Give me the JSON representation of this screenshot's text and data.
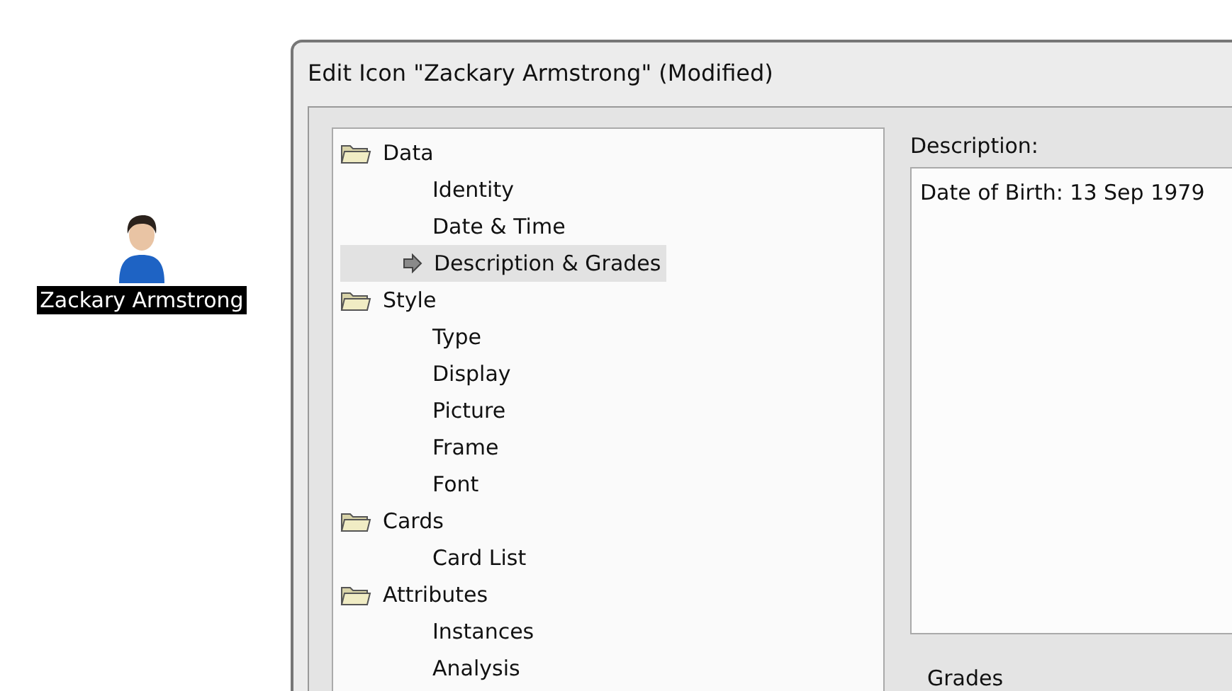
{
  "desktop_icon": {
    "label": "Zackary Armstrong",
    "selected": true
  },
  "dialog": {
    "title": "Edit Icon \"Zackary Armstrong\" (Modified)",
    "tree": [
      {
        "label": "Data",
        "selected": false,
        "children": [
          {
            "label": "Identity",
            "selected": false
          },
          {
            "label": "Date & Time",
            "selected": false
          },
          {
            "label": "Description & Grades",
            "selected": true
          }
        ]
      },
      {
        "label": "Style",
        "selected": false,
        "children": [
          {
            "label": "Type",
            "selected": false
          },
          {
            "label": "Display",
            "selected": false
          },
          {
            "label": "Picture",
            "selected": false
          },
          {
            "label": "Frame",
            "selected": false
          },
          {
            "label": "Font",
            "selected": false
          }
        ]
      },
      {
        "label": "Cards",
        "selected": false,
        "children": [
          {
            "label": "Card List",
            "selected": false
          }
        ]
      },
      {
        "label": "Attributes",
        "selected": false,
        "children": [
          {
            "label": "Instances",
            "selected": false
          },
          {
            "label": "Analysis",
            "selected": false
          }
        ]
      }
    ],
    "description_label": "Description:",
    "description_value": "Date of Birth: 13 Sep 1979",
    "grades_label": "Grades"
  }
}
